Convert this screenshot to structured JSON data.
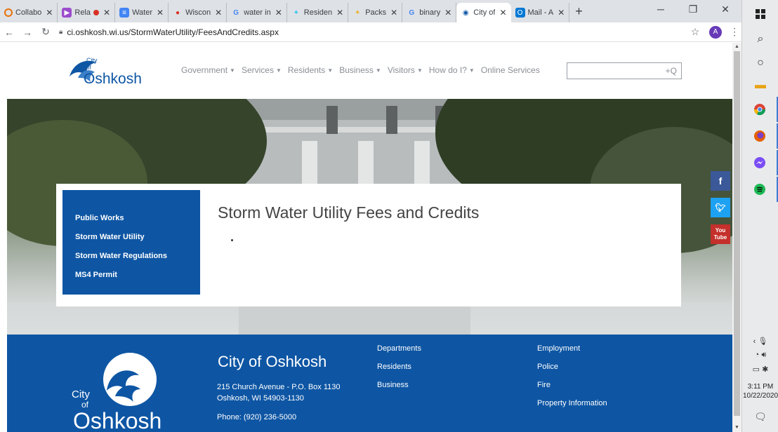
{
  "browser": {
    "tabs": [
      {
        "title": "Collabo",
        "icon": "collab-icon",
        "active": false
      },
      {
        "title": "Rela",
        "icon": "video-icon",
        "active": false,
        "recording": true
      },
      {
        "title": "Water",
        "icon": "docs-icon",
        "active": false
      },
      {
        "title": "Wiscon",
        "icon": "map-icon",
        "active": false
      },
      {
        "title": "water in",
        "icon": "google-icon",
        "active": false
      },
      {
        "title": "Residen",
        "icon": "slack-icon",
        "active": false
      },
      {
        "title": "Packs",
        "icon": "slack-icon",
        "active": false
      },
      {
        "title": "binary",
        "icon": "google-icon",
        "active": false
      },
      {
        "title": "City of",
        "icon": "oshkosh-icon",
        "active": true
      },
      {
        "title": "Mail - A",
        "icon": "outlook-icon",
        "active": false
      }
    ],
    "url": "ci.oshkosh.wi.us/StormWaterUtility/FeesAndCredits.aspx",
    "profile_initial": "A"
  },
  "site": {
    "logo": {
      "small": "City",
      "of": "of",
      "name": "Oshkosh"
    },
    "nav": [
      "Government",
      "Services",
      "Residents",
      "Business",
      "Visitors",
      "How do I?",
      "Online Services"
    ],
    "nav_has_caret": [
      true,
      true,
      true,
      true,
      true,
      true,
      false
    ],
    "search_icon": "+Q"
  },
  "sidenav": [
    "Public Works",
    "Storm Water Utility",
    "Storm Water Regulations",
    "MS4 Permit"
  ],
  "main": {
    "title": "Storm Water Utility Fees and Credits"
  },
  "social": {
    "facebook": "f",
    "twitter": "t",
    "youtube": "You Tube"
  },
  "footer": {
    "city": "City of Oshkosh",
    "address_line1": "215 Church Avenue - P.O. Box 1130",
    "address_line2": "Oshkosh, WI 54903-1130",
    "phone": "Phone: (920) 236-5000",
    "col1": [
      "Departments",
      "Residents",
      "Business"
    ],
    "col2": [
      "Employment",
      "Police",
      "Fire",
      "Property Information"
    ],
    "logo": {
      "small": "City",
      "of": "of",
      "name": "Oshkosh"
    }
  },
  "taskbar": {
    "time": "3:11 PM",
    "date": "10/22/2020"
  },
  "colors": {
    "brand_blue": "#0e56a4",
    "nav_gray": "#8a8f96",
    "title_gray": "#444444"
  }
}
